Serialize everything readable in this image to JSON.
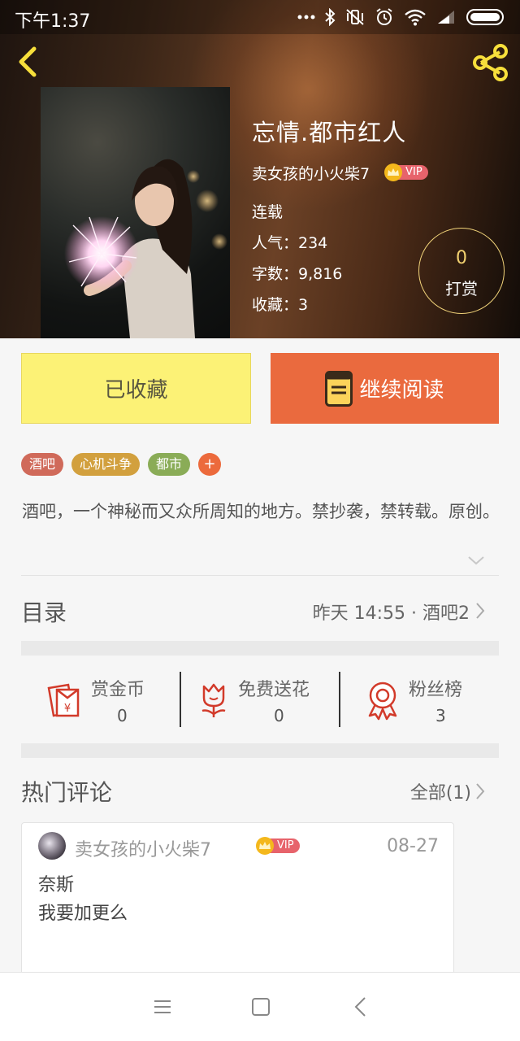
{
  "status_bar": {
    "time": "下午1:37",
    "icons": [
      "more-dots-icon",
      "bluetooth-icon",
      "vibrate-mute-icon",
      "alarm-icon",
      "wifi-icon",
      "signal-icon",
      "battery-icon"
    ]
  },
  "header": {
    "back_icon": "chevron-left-icon",
    "share_icon": "share-icon"
  },
  "book": {
    "title": "忘情.都市红人",
    "author": "卖女孩的小火柴7",
    "vip_badge": "VIP",
    "status": "连载",
    "popularity": "人气：234",
    "word_count": "字数：9,816",
    "favorites": "收藏：3",
    "reward_count": "0",
    "reward_label": "打赏"
  },
  "actions": {
    "collect_label": "已收藏",
    "read_label": "继续阅读"
  },
  "tags": [
    {
      "label": "酒吧",
      "color": "#d06a5a"
    },
    {
      "label": "心机斗争",
      "color": "#d2a03e"
    },
    {
      "label": "都市",
      "color": "#8aac57"
    }
  ],
  "tag_add": "+",
  "description": "酒吧，一个神秘而又众所周知的地方。禁抄袭，禁转载。原创。",
  "toc": {
    "title": "目录",
    "latest": "昨天 14:55 · 酒吧2"
  },
  "stats": [
    {
      "label": "赏金币",
      "value": "0",
      "icon": "red-envelope-icon"
    },
    {
      "label": "免费送花",
      "value": "0",
      "icon": "flower-icon"
    },
    {
      "label": "粉丝榜",
      "value": "3",
      "icon": "medal-icon"
    }
  ],
  "comments": {
    "title": "热门评论",
    "all_label": "全部(1)",
    "items": [
      {
        "user": "卖女孩的小火柴7",
        "vip": "VIP",
        "date": "08-27",
        "lines": [
          "奈斯",
          "我要加更么"
        ]
      }
    ]
  },
  "colors": {
    "accent_orange": "#ea6a3e",
    "collect_yellow": "#fcf276",
    "reward_gold": "#f3d270",
    "icon_red": "#d23a2a"
  }
}
